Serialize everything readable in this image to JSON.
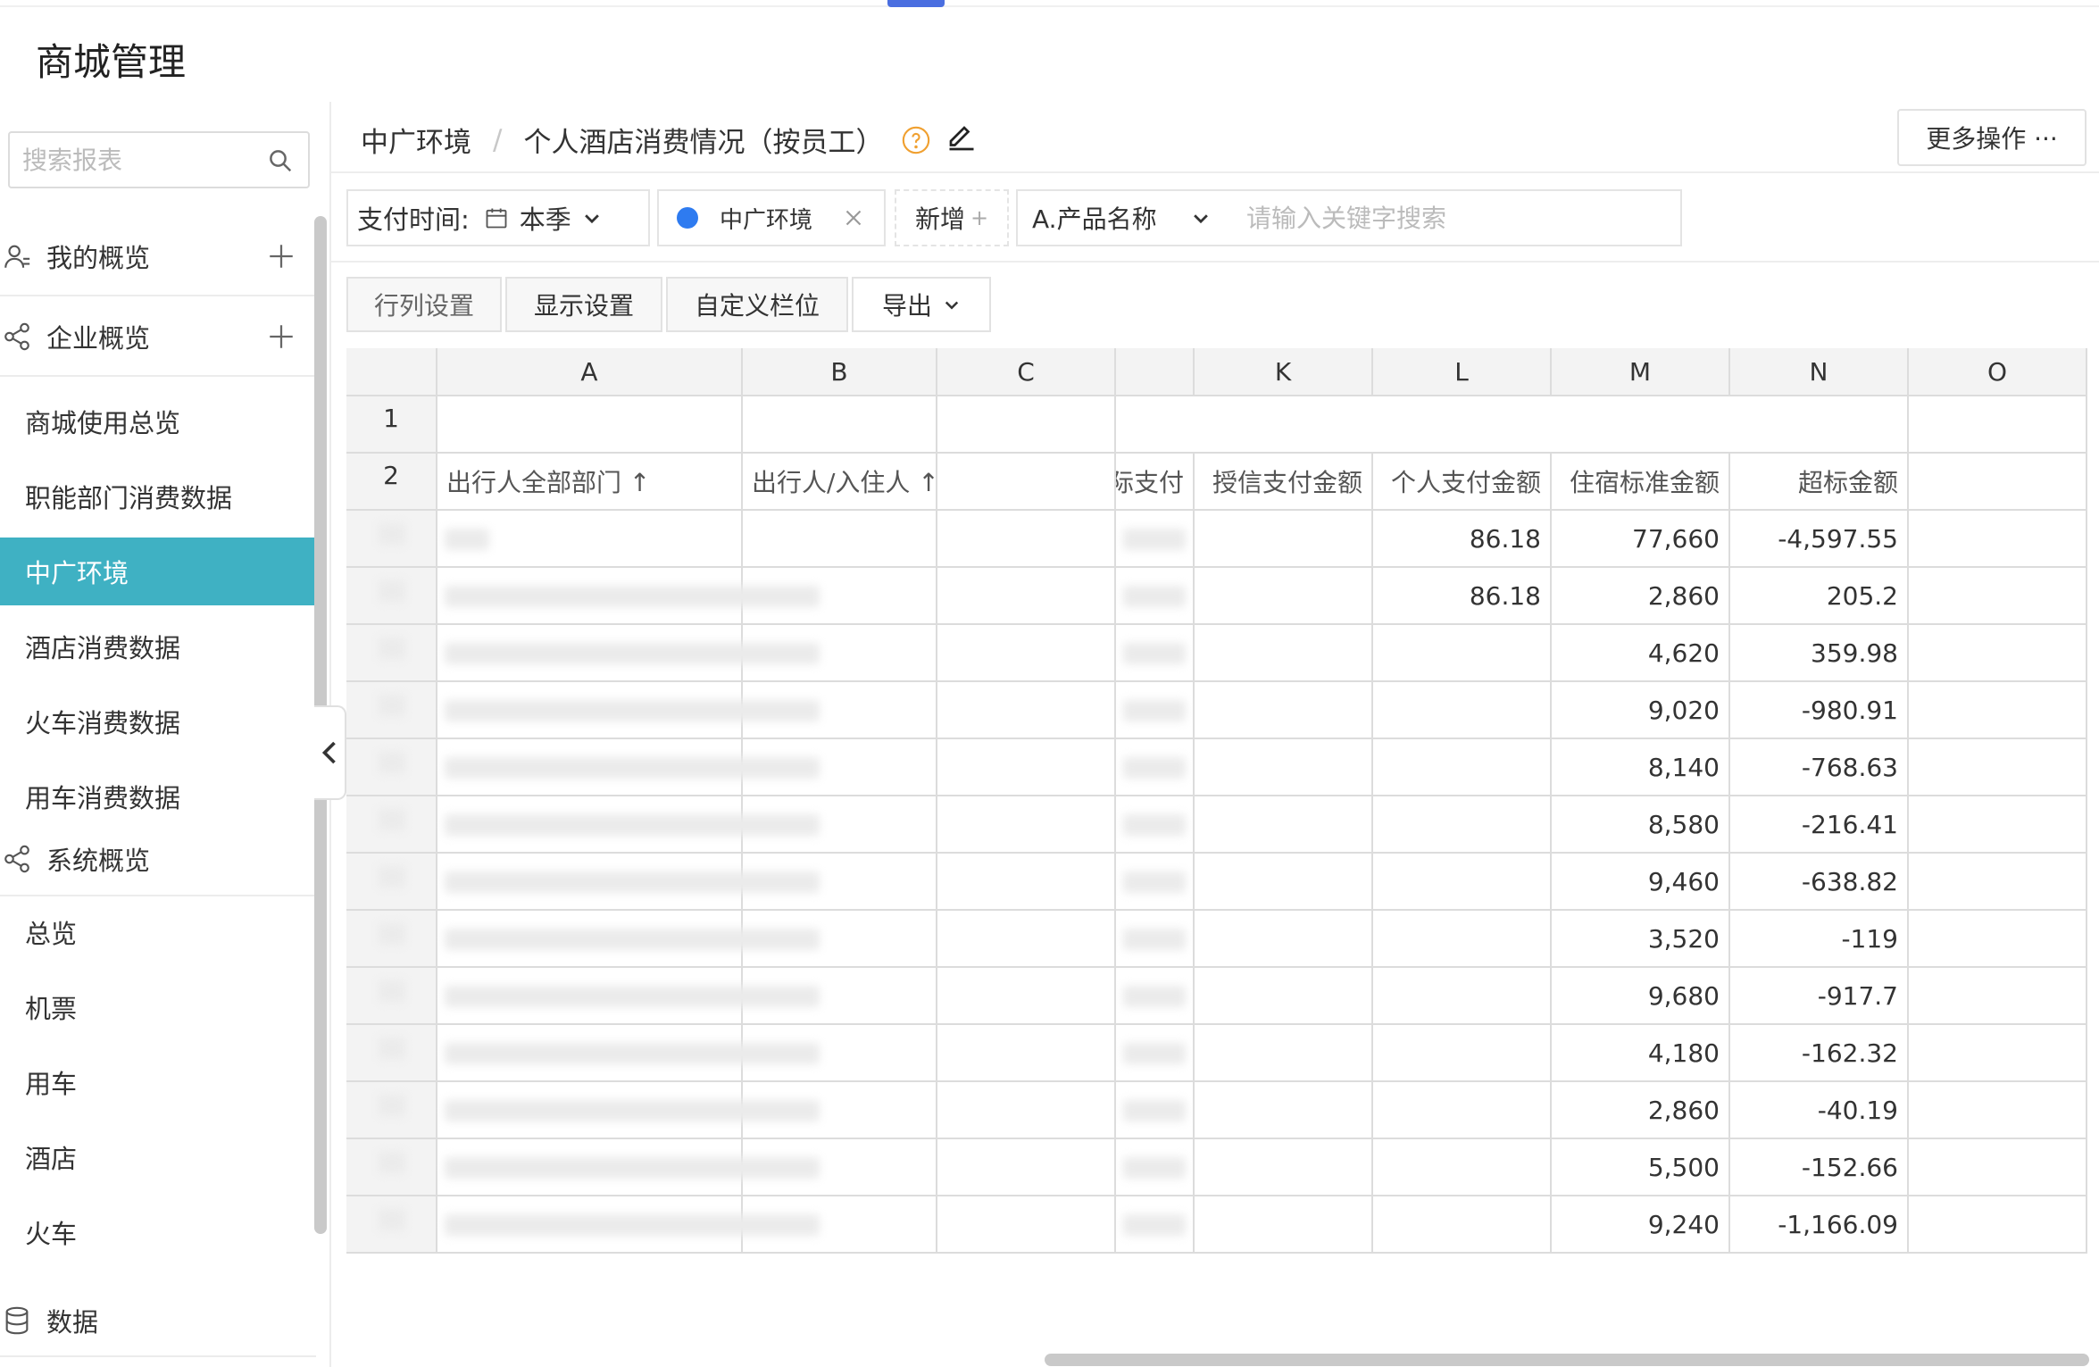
{
  "app": {
    "title": "商城管理"
  },
  "sidebar": {
    "search_placeholder": "搜索报表",
    "groups": [
      {
        "label": "我的概览",
        "icon": "user-icon"
      },
      {
        "label": "企业概览",
        "icon": "share-icon"
      }
    ],
    "items_a": [
      "商城使用总览",
      "职能部门消费数据",
      "中广环境",
      "酒店消费数据",
      "火车消费数据",
      "用车消费数据"
    ],
    "active_item": "中广环境",
    "system_group": {
      "label": "系统概览",
      "icon": "share-icon"
    },
    "items_b": [
      "总览",
      "机票",
      "用车",
      "酒店",
      "火车"
    ],
    "data_group": {
      "label": "数据",
      "icon": "database-icon"
    }
  },
  "header": {
    "breadcrumb": [
      "中广环境",
      "个人酒店消费情况（按员工）"
    ],
    "more_actions": "更多操作 ···"
  },
  "filters": {
    "time_label": "支付时间:",
    "time_value": "本季",
    "tag": "中广环境",
    "add_label": "新增",
    "add_plus": "+",
    "product_field": "A.产品名称",
    "keyword_placeholder": "请输入关键字搜索"
  },
  "toolbar": {
    "row_col_settings": "行列设置",
    "display_settings": "显示设置",
    "custom_columns": "自定义栏位",
    "export": "导出"
  },
  "sheet": {
    "columns": [
      "A",
      "B",
      "C",
      "K",
      "L",
      "M",
      "N",
      "O"
    ],
    "row_numbers": [
      "1",
      "2"
    ],
    "headers": {
      "a": "出行人全部部门 ↑",
      "b": "出行人/入住人 ↑",
      "j_partial": "际支付",
      "k": "授信支付金额",
      "l": "个人支付金额",
      "m": "住宿标准金额",
      "n": "超标金额"
    },
    "rows": [
      {
        "l": "86.18",
        "m": "77,660",
        "n": "-4,597.55"
      },
      {
        "l": "86.18",
        "m": "2,860",
        "n": "205.2"
      },
      {
        "l": "",
        "m": "4,620",
        "n": "359.98"
      },
      {
        "l": "",
        "m": "9,020",
        "n": "-980.91"
      },
      {
        "l": "",
        "m": "8,140",
        "n": "-768.63"
      },
      {
        "l": "",
        "m": "8,580",
        "n": "-216.41"
      },
      {
        "l": "",
        "m": "9,460",
        "n": "-638.82"
      },
      {
        "l": "",
        "m": "3,520",
        "n": "-119"
      },
      {
        "l": "",
        "m": "9,680",
        "n": "-917.7"
      },
      {
        "l": "",
        "m": "4,180",
        "n": "-162.32"
      },
      {
        "l": "",
        "m": "2,860",
        "n": "-40.19"
      },
      {
        "l": "",
        "m": "5,500",
        "n": "-152.66"
      },
      {
        "l": "",
        "m": "9,240",
        "n": "-1,166.09"
      }
    ]
  },
  "colors": {
    "accent_active": "#3fb1c3",
    "tag_dot": "#2e7bf0",
    "help_icon": "#f0a030"
  }
}
